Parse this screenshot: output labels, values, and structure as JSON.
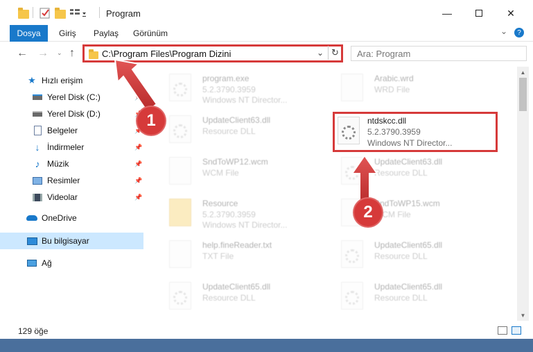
{
  "window": {
    "title": "Program",
    "minimize_icon": "minimize-icon",
    "maximize_icon": "maximize-icon",
    "close_icon": "close-icon"
  },
  "ribbon": {
    "tabs": [
      "Dosya",
      "Giriş",
      "Paylaş",
      "Görünüm"
    ],
    "expand_glyph": "⌄",
    "help_glyph": "?"
  },
  "address": {
    "path": "C:\\Program Files\\Program Dizini",
    "dropdown_glyph": "⌄",
    "refresh_glyph": "↻"
  },
  "search": {
    "placeholder": "Ara: Program"
  },
  "sidebar": {
    "items": [
      {
        "label": "Hızlı erişim",
        "icon": "star-icon"
      },
      {
        "label": "Yerel Disk (C:)",
        "icon": "drive-icon"
      },
      {
        "label": "Yerel Disk (D:)",
        "icon": "drive-icon"
      },
      {
        "label": "Belgeler",
        "icon": "documents-icon"
      },
      {
        "label": "İndirmeler",
        "icon": "download-icon"
      },
      {
        "label": "Müzik",
        "icon": "music-icon"
      },
      {
        "label": "Resimler",
        "icon": "pictures-icon"
      },
      {
        "label": "Videolar",
        "icon": "videos-icon"
      },
      {
        "label": "OneDrive",
        "icon": "cloud-icon"
      },
      {
        "label": "Bu bilgisayar",
        "icon": "computer-icon"
      },
      {
        "label": "Ağ",
        "icon": "network-icon"
      }
    ]
  },
  "files": {
    "left": [
      {
        "name": "program.exe",
        "line1": "5.2.3790.3959",
        "line2": "Windows NT Director..."
      },
      {
        "name": "UpdateClient63.dll",
        "line1": "Resource DLL",
        "line2": ""
      },
      {
        "name": "SndToWP12.wcm",
        "line1": "WCM File",
        "line2": ""
      },
      {
        "name": "Resource",
        "line1": "5.2.3790.3959",
        "line2": "Windows NT Director..."
      },
      {
        "name": "help.fineReader.txt",
        "line1": "TXT File",
        "line2": ""
      },
      {
        "name": "UpdateClient65.dll",
        "line1": "Resource DLL",
        "line2": ""
      }
    ],
    "right": [
      {
        "name": "Arabic.wrd",
        "line1": "WRD File",
        "line2": ""
      },
      {
        "name": "ntdskcc.dll",
        "line1": "5.2.3790.3959",
        "line2": "Windows NT Director..."
      },
      {
        "name": "UpdateClient63.dll",
        "line1": "Resource DLL",
        "line2": ""
      },
      {
        "name": "SndToWP15.wcm",
        "line1": "WCM File",
        "line2": ""
      },
      {
        "name": "UpdateClient65.dll",
        "line1": "Resource DLL",
        "line2": ""
      },
      {
        "name": "UpdateClient65.dll",
        "line1": "Resource DLL",
        "line2": ""
      }
    ]
  },
  "status": {
    "count": "129 öğe"
  },
  "callouts": [
    "1",
    "2"
  ],
  "colors": {
    "accent": "#1979ca",
    "highlight": "#d63a3a",
    "selected": "#cce8ff"
  }
}
